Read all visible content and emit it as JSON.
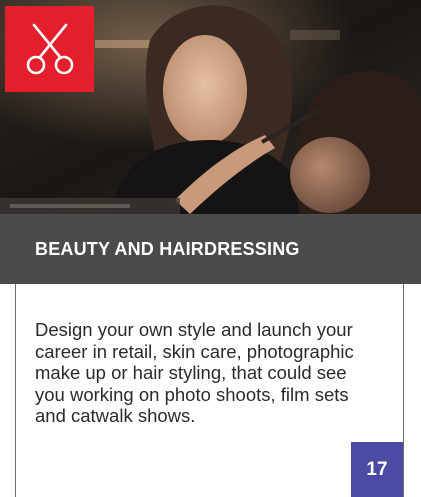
{
  "header": {
    "photo": "beauty-makeup-photo",
    "icon": "scissors-icon",
    "icon_color": "#e31f2b"
  },
  "band": {
    "title": "BEAUTY AND HAIRDRESSING",
    "color": "#4b4b4a"
  },
  "body": {
    "description": "Design your own style and launch your career in retail, skin care, photographic make up or hair styling, that could see you working on photo shoots, film sets and catwalk shows."
  },
  "page": {
    "number": "17",
    "color": "#4d4aa3"
  }
}
